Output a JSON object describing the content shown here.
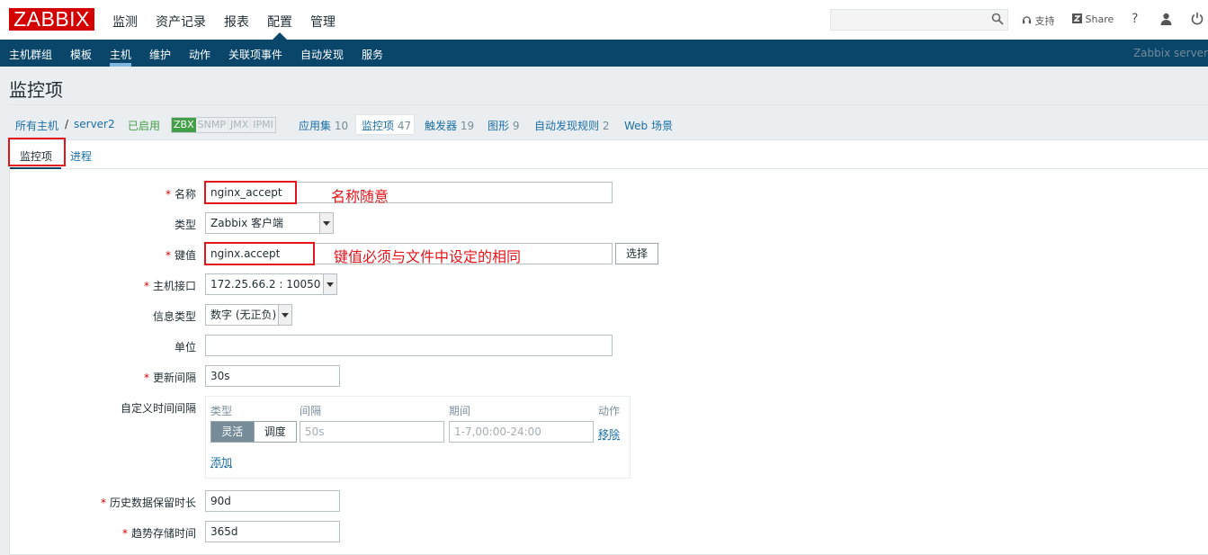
{
  "header": {
    "logo": "ZABBIX",
    "menu": [
      "监测",
      "资产记录",
      "报表",
      "配置",
      "管理"
    ],
    "support": "支持",
    "share": "Share",
    "help": "?"
  },
  "navbar": {
    "items": [
      "主机群组",
      "模板",
      "主机",
      "维护",
      "动作",
      "关联项事件",
      "自动发现",
      "服务"
    ],
    "server": "Zabbix server"
  },
  "page": {
    "title": "监控项"
  },
  "hostnav": {
    "all_hosts": "所有主机",
    "slash": "/",
    "host": "server2",
    "status": "已启用",
    "availability": [
      "ZBX",
      "SNMP",
      "JMX",
      "IPMI"
    ],
    "apps": "应用集",
    "apps_count": "10",
    "items": "监控项",
    "items_count": "47",
    "triggers": "触发器",
    "triggers_count": "19",
    "graphs": "图形",
    "graphs_count": "9",
    "discovery": "自动发现规则",
    "discovery_count": "2",
    "web": "Web 场景"
  },
  "tabs": {
    "item": "监控项",
    "preprocessing": "进程"
  },
  "form": {
    "name_label": "名称",
    "name_value": "nginx_accept",
    "type_label": "类型",
    "type_value": "Zabbix 客户端",
    "key_label": "键值",
    "key_value": "nginx.accept",
    "select_button": "选择",
    "interface_label": "主机接口",
    "interface_value": "172.25.66.2 : 10050",
    "info_type_label": "信息类型",
    "info_type_value": "数字 (无正负)",
    "units_label": "单位",
    "units_value": "",
    "interval_label": "更新间隔",
    "interval_value": "30s",
    "custom_label": "自定义时间间隔",
    "custom_headers": [
      "类型",
      "间隔",
      "期间",
      "动作"
    ],
    "flex_label": "灵活",
    "sched_label": "调度",
    "custom_interval_ph": "50s",
    "custom_period_ph": "1-7,00:00-24:00",
    "remove": "移除",
    "add": "添加",
    "history_label": "历史数据保留时长",
    "history_value": "90d",
    "trends_label": "趋势存储时间",
    "trends_value": "365d"
  },
  "annotations": {
    "name_note": "名称随意",
    "key_note": "键值必须与文件中设定的相同"
  },
  "colors": {
    "brand_red": "#d40000",
    "nav_blue": "#0a466a",
    "annotation_red": "#e3141b"
  }
}
